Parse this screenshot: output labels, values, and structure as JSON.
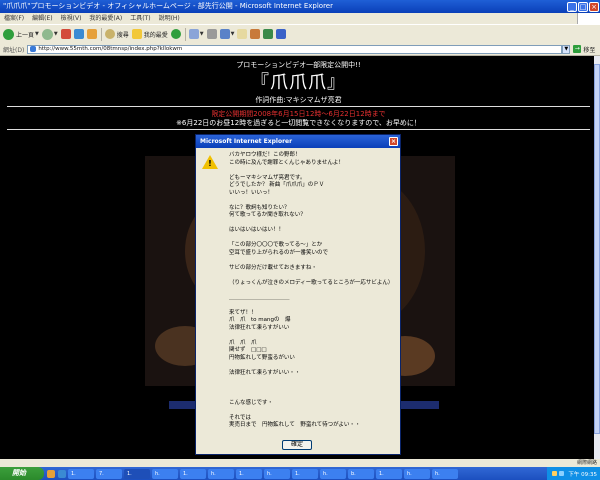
{
  "window": {
    "title": "\"爪爪爪\"プロモーションビデオ - オフィシャルホームページ - 部先行公開 - Microsoft Internet Explorer"
  },
  "menubar": {
    "items": [
      "檔案(F)",
      "編輯(E)",
      "檢視(V)",
      "我的最愛(A)",
      "工具(T)",
      "說明(H)"
    ]
  },
  "toolbar": {
    "back_label": "上一頁",
    "search_label": "搜尋",
    "favorites_label": "我的最愛"
  },
  "address": {
    "label": "網址(D)",
    "url": "http://www.55mth.com/08tmnsp/index.php?kllokwm",
    "go_label": "移至"
  },
  "page": {
    "promo_line": "プロモーションビデオ一部限定公開中!!",
    "logo_text": "『爪爪爪』",
    "credits_line": "作詞作曲:マキシマムザ亮君",
    "limited_line": "限定公開期間2008年6月15日12時〜6月22日12時まで",
    "notice_line": "※6月22日のお昼12時を過ぎると一切閲覧できなくなりますので、お早めに！"
  },
  "dialog": {
    "title": "Microsoft Internet Explorer",
    "ok_label": "確定",
    "lines": [
      "バカヤロウ様だ！この野郎！",
      "この時に及んで謝罪とくんじゃありませんよ！",
      "",
      "どもーマキシマムザ亮君です。",
      "どうでしたか？ 新曲「爪爪爪」のＰＶ",
      "いいっ！いいっ！",
      "",
      "なに？歌詞も知りたい？",
      "何て歌ってるか聞き取れない？",
      "",
      "はいはいはいはい！！",
      "",
      "「この部分〇〇〇で歌ってる〜」とか",
      "空耳で盛り上がられるのが一番笑いので",
      "",
      "サビの部分だけ載せておきますね・",
      "",
      "（りょっくんが泣きのメロディー歌ってるところが一応サビよん）",
      "",
      "＿＿＿＿＿＿＿＿＿＿＿",
      "",
      "来てザ！！",
      "爪　爪　to mangの　爆",
      "法律狂れて凍らすがいい",
      "",
      "爪　爪　爪",
      "関せず　□□□",
      "円物鉱れして野蛮るがいい",
      "",
      "法律狂れて凍らすがいい・・",
      "",
      "",
      "",
      "こんな感じです・",
      "",
      "それでは",
      "実売日まで　円物鉱れして　野蛮れて待つがよい・・"
    ]
  },
  "statusbar": {
    "zone": "網際網路"
  },
  "taskbar": {
    "start_label": "開始",
    "tasks": [
      "1.",
      "7.",
      "1.",
      "h.",
      "1.",
      "h.",
      "1.",
      "h.",
      "1.",
      "h.",
      "b.",
      "1.",
      "h.",
      "h."
    ],
    "clock": "下午 09:35"
  }
}
